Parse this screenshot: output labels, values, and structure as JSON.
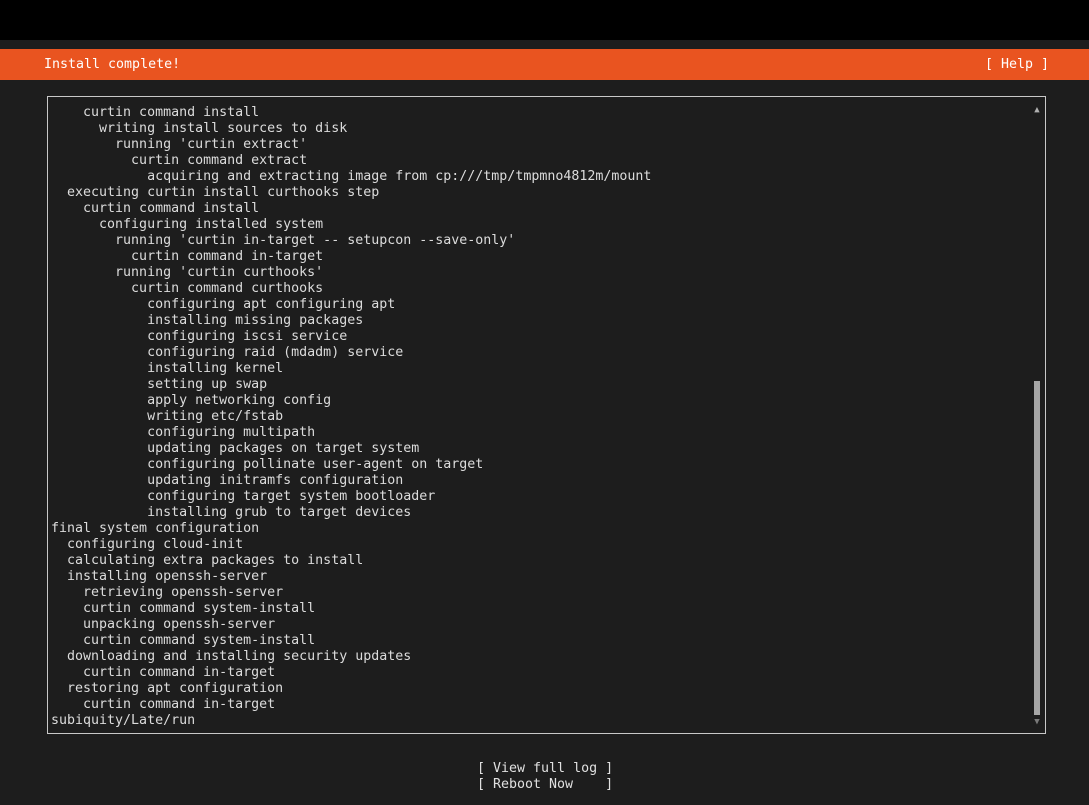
{
  "header": {
    "title": "Install complete!",
    "help_label": "[ Help ]"
  },
  "log": {
    "lines": [
      "    curtin command install",
      "      writing install sources to disk",
      "        running 'curtin extract'",
      "          curtin command extract",
      "            acquiring and extracting image from cp:///tmp/tmpmno4812m/mount",
      "  executing curtin install curthooks step",
      "    curtin command install",
      "      configuring installed system",
      "        running 'curtin in-target -- setupcon --save-only'",
      "          curtin command in-target",
      "        running 'curtin curthooks'",
      "          curtin command curthooks",
      "            configuring apt configuring apt",
      "            installing missing packages",
      "            configuring iscsi service",
      "            configuring raid (mdadm) service",
      "            installing kernel",
      "            setting up swap",
      "            apply networking config",
      "            writing etc/fstab",
      "            configuring multipath",
      "            updating packages on target system",
      "            configuring pollinate user-agent on target",
      "            updating initramfs configuration",
      "            configuring target system bootloader",
      "            installing grub to target devices",
      "final system configuration",
      "  configuring cloud-init",
      "  calculating extra packages to install",
      "  installing openssh-server",
      "    retrieving openssh-server",
      "    curtin command system-install",
      "    unpacking openssh-server",
      "    curtin command system-install",
      "  downloading and installing security updates",
      "    curtin command in-target",
      "  restoring apt configuration",
      "    curtin command in-target",
      "subiquity/Late/run"
    ],
    "scroll": {
      "up_arrow": "▲",
      "down_arrow": "▼",
      "thumb_start_fraction": 0.44,
      "thumb_end_fraction": 1.0
    }
  },
  "actions": {
    "view_full_log": "[ View full log ]",
    "reboot_now": "[ Reboot Now    ]"
  },
  "colors": {
    "accent": "#e95420",
    "background": "#1d1d1d",
    "text": "#dcdcdc"
  }
}
